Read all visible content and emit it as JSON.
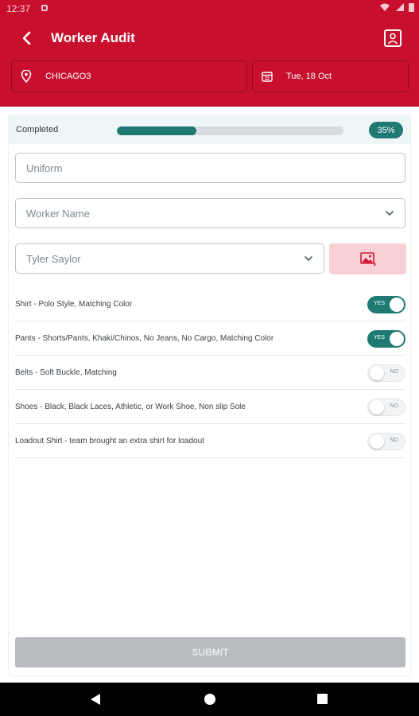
{
  "status_bar": {
    "time": "12:37"
  },
  "header": {
    "title": "Worker Audit",
    "location": "CHICAGO3",
    "date": "Tue, 18 Oct"
  },
  "progress": {
    "label": "Completed",
    "percent": 35,
    "percent_text": "35%"
  },
  "fields": {
    "uniform_placeholder": "Uniform",
    "worker_name_placeholder": "Worker Name",
    "selected_worker": "Tyler Saylor"
  },
  "checklist": [
    {
      "label": "Shirt - Polo Style, Matching Color",
      "value": true,
      "toggle_text": "YES"
    },
    {
      "label": "Pants - Shorts/Pants, Khaki/Chinos, No Jeans, No Cargo, Matching Color",
      "value": true,
      "toggle_text": "YES"
    },
    {
      "label": "Belts - Soft Buckle, Matching",
      "value": false,
      "toggle_text": "NO"
    },
    {
      "label": "Shoes - Black, Black Laces, Athletic, or Work Shoe, Non slip Sole",
      "value": false,
      "toggle_text": "NO"
    },
    {
      "label": "Loadout Shirt -  team brought an extra shirt for loadout",
      "value": false,
      "toggle_text": "NO"
    }
  ],
  "submit_label": "SUBMIT",
  "colors": {
    "brand_red": "#c8102e",
    "accent_teal": "#1f7a74",
    "disabled_gray": "#b8bcc1",
    "image_button_bg": "#f9d0d6"
  },
  "icons": {
    "back": "arrow-left-icon",
    "profile": "user-profile-icon",
    "location": "map-pin-icon",
    "date": "calendar-icon",
    "dropdown": "chevron-down-icon",
    "image": "image-icon"
  }
}
